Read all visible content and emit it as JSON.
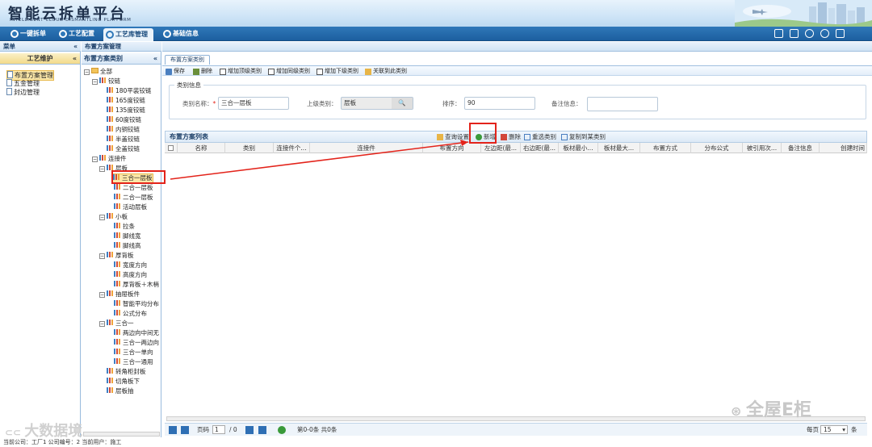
{
  "header": {
    "title_cn": "智能云拆单平台",
    "title_en": "INTELLIGENT CLOUD DISMANTLING PLATFORM"
  },
  "nav": {
    "items": [
      {
        "label": "一键拆单"
      },
      {
        "label": "工艺配置"
      },
      {
        "label": "工艺库管理"
      },
      {
        "label": "基础信息"
      }
    ]
  },
  "left_panel": {
    "title": "菜单",
    "section": "工艺维护",
    "items": [
      {
        "label": "布置方案管理"
      },
      {
        "label": "五金管理"
      },
      {
        "label": "封边管理"
      }
    ]
  },
  "mid_panel": {
    "title": "布置方案管理",
    "section": "布置方案类别",
    "tree": [
      {
        "label": "全部"
      },
      {
        "label": "铰链"
      },
      {
        "label": "180平装铰链"
      },
      {
        "label": "165度铰链"
      },
      {
        "label": "135度铰链"
      },
      {
        "label": "60度铰链"
      },
      {
        "label": "内铜铰链"
      },
      {
        "label": "半盖铰链"
      },
      {
        "label": "全盖铰链"
      },
      {
        "label": "连接件"
      },
      {
        "label": "层板"
      },
      {
        "label": "三合一层板"
      },
      {
        "label": "二合一层板"
      },
      {
        "label": "二合一层板"
      },
      {
        "label": "活动层板"
      },
      {
        "label": "小板"
      },
      {
        "label": "拉条"
      },
      {
        "label": "脚线宽"
      },
      {
        "label": "脚线高"
      },
      {
        "label": "厚背板"
      },
      {
        "label": "宽度方向"
      },
      {
        "label": "高度方向"
      },
      {
        "label": "厚背板＋木梢"
      },
      {
        "label": "抽屉板件"
      },
      {
        "label": "智能平均分布"
      },
      {
        "label": "公式分布"
      },
      {
        "label": "三合一"
      },
      {
        "label": "两边向中间无"
      },
      {
        "label": "三合一两边向"
      },
      {
        "label": "三合一单向"
      },
      {
        "label": "三合一通用"
      },
      {
        "label": "转角柜封板"
      },
      {
        "label": "切角板下"
      },
      {
        "label": "层板抽"
      }
    ]
  },
  "right_panel": {
    "tab": "布置方案类别",
    "toolbar": [
      "保存",
      "删除",
      "增加顶级类别",
      "增加同级类别",
      "增加下级类别",
      "关联到此类别"
    ],
    "form": {
      "legend": "类别信息",
      "name_label": "类别名称：",
      "name_value": "三合一层板",
      "parent_label": "上级类别：",
      "parent_value": "层板",
      "order_label": "排序：",
      "order_value": "90",
      "remark_label": "备注信息："
    },
    "list": {
      "title": "布置方案列表",
      "tools": [
        "查询设置",
        "新增",
        "删除",
        "重选类别",
        "复制到某类别"
      ],
      "columns": [
        "名称",
        "类别",
        "连接件个...",
        "连接件",
        "布置方向",
        "左边距(最...",
        "右边距(最...",
        "板材最小...",
        "板材最大...",
        "布置方式",
        "分布公式",
        "被引用次...",
        "备注信息",
        "创建时间"
      ]
    },
    "pager": {
      "page_label": "页码",
      "page_value": "1",
      "total_pages": "/ 0",
      "record_info": "第0-0条  共0条",
      "per_page_label": "每页",
      "per_page_value": "15",
      "unit": "条"
    }
  },
  "statusbar": {
    "text": "当前公司：工厂1    公司编号：2    当前用户：施工"
  },
  "watermarks": {
    "left": "大数据境",
    "right": "全屋E柜"
  }
}
